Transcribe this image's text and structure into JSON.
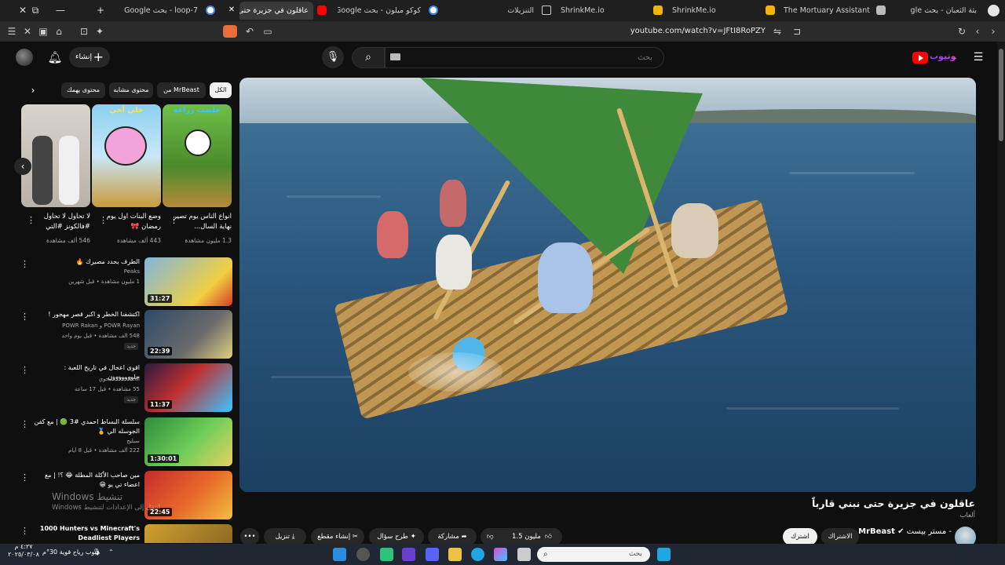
{
  "browser": {
    "window_controls": [
      "✕",
      "⧉",
      "—"
    ],
    "new_tab": "+",
    "tabs": [
      {
        "label": "loop-7 - بحث Google",
        "icon": "google-icon"
      },
      {
        "label": "عاقلون في جزيرة حتى",
        "icon": "youtube-icon",
        "active": true
      },
      {
        "label": "كوكو ميلون - بحث Google",
        "icon": "google-icon"
      },
      {
        "label": "التنزيلات",
        "icon": "download-icon"
      },
      {
        "label": "ShrinkMe.io",
        "icon": "hand-icon"
      },
      {
        "label": "ShrinkMe.io",
        "icon": "hand-icon"
      },
      {
        "label": "The Mortuary Assistant Price",
        "icon": "database-icon"
      },
      {
        "label": "بثة الثعبان - بحث Google",
        "icon": "google-icon"
      }
    ],
    "url": "youtube.com/watch?v=JFtI8RoPZY"
  },
  "youtube": {
    "create_label": "إنشاء",
    "search_placeholder": "بحث",
    "video": {
      "title": "عاقلون في جزيرة حتى نبني قارباً",
      "game_label": "ألعاب",
      "channel": "MrBeast",
      "channel_suffix": "- مستر بيست",
      "subscribe": "اشترك",
      "join": "الاشتراك",
      "likes": "1.5 مليون",
      "share": "مشاركة",
      "ask": "طرح سؤال",
      "clip": "إنشاء مقطع",
      "download": "تنزيل",
      "more": "•••"
    },
    "chips": [
      "الكل",
      "من MrBeast",
      "محتوى مشابه",
      "محتوى يهمك"
    ],
    "shorts": [
      {
        "tag": "خلصت زراعة",
        "tag_color": "#39c6ff",
        "title": "انواع الناس يوم تصير نهاية السال...",
        "views": "1.3 مليون مشاهدة"
      },
      {
        "tag": "خلي أخي",
        "tag_color": "#ffe14a",
        "title": "وضع البنات اول يوم رمضان 🎀",
        "views": "443 ألف مشاهدة"
      },
      {
        "tag": "",
        "tag_color": "#ffffff",
        "title": "لا تحاول لا تحاول #فالكونز #التي",
        "views": "546 ألف مشاهدة"
      }
    ],
    "recommendations": [
      {
        "title": "الطرف بحدد مصيرك 🔥",
        "channel": "Peaks",
        "meta": "1 مليون مشاهدة • قبل شهرين",
        "duration": "31:27",
        "badge": ""
      },
      {
        "title": "اكتشفنا الخطر و اكبر قصر مهجور !",
        "channel": "POWR Rayan و POWR Rakan",
        "meta": "548 ألف مشاهدة • قبل يوم واحد",
        "duration": "22:39",
        "badge": "جديد"
      },
      {
        "title": "اقوى اعجال في تاريخ اللعبة : جلووووووون",
        "channel": "The Real البحوي",
        "meta": "55 مشاهدة • قبل 17 ساعة",
        "duration": "11:37",
        "badge": "جديد"
      },
      {
        "title": "سلسلة البساط احمدي #3 🟢 | مع كفن الجوسله الي 🏅",
        "channel": "سبليج",
        "meta": "222 ألف مشاهدة • قبل 8 أيام",
        "duration": "1:30:01",
        "badge": ""
      },
      {
        "title": "مين صاحب الأكلة المطلة 😂 ؟! | مع اعضاء تي يو 😁",
        "channel": "",
        "meta": "",
        "duration": "22:45",
        "badge": ""
      },
      {
        "title": "1000 Hunters vs Minecraft's Deadliest Players",
        "channel": "",
        "meta": "",
        "duration": "",
        "badge": ""
      }
    ]
  },
  "watermark": {
    "line1": "Windows تنشيط",
    "line2": "Windows انتقل إلى الإعدادات لتنشيط"
  },
  "taskbar": {
    "search_placeholder": "بحث",
    "clock": "٤:٢٧ م",
    "date": "٢٠٢٥/٠٣/٠٨",
    "weather": "هبوب رياح قوية 30°م"
  }
}
